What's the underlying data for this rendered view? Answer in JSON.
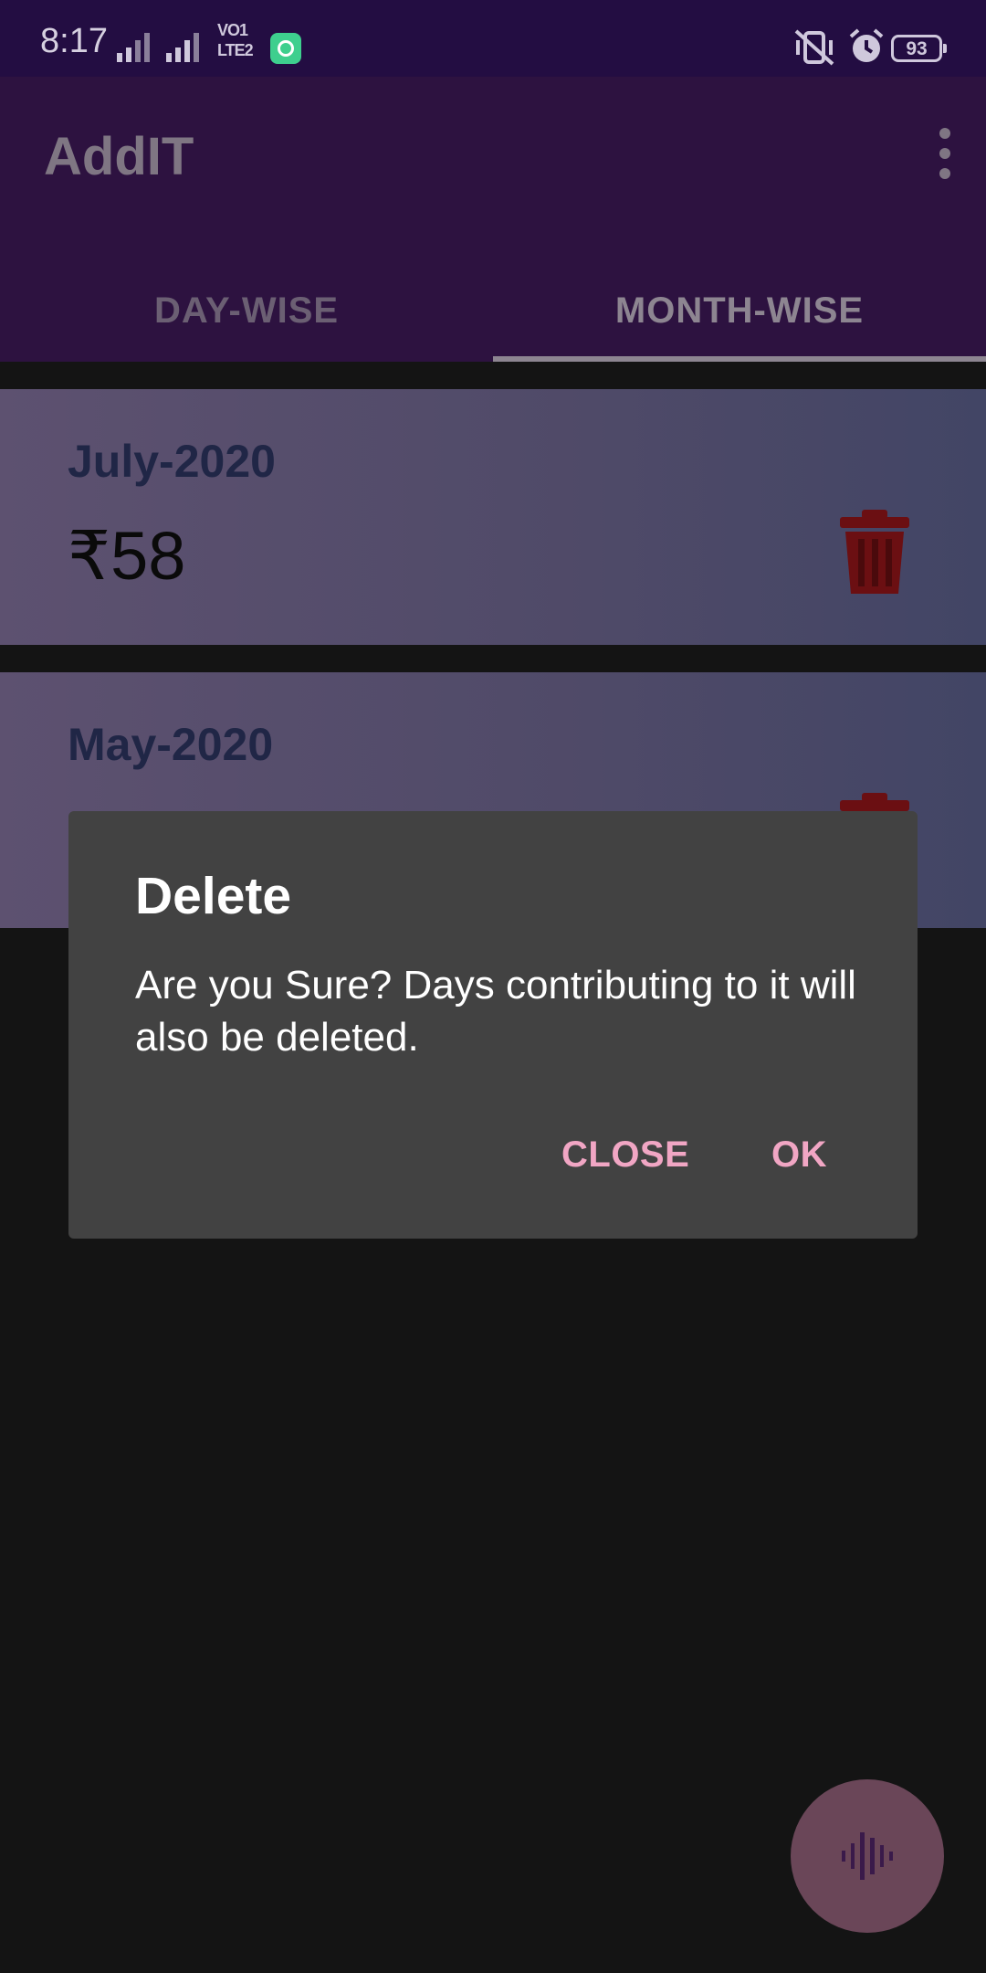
{
  "status_bar": {
    "time": "8:17",
    "network_label_top": "VO",
    "network_label_bottom": "LTE",
    "sim_top": "1",
    "sim_bottom": "2",
    "battery": "93",
    "icons": [
      "signal-icon",
      "signal-icon",
      "volte-icon",
      "app-notification-icon",
      "vibrate-icon",
      "alarm-icon",
      "battery-icon"
    ]
  },
  "app_bar": {
    "title": "AddIT",
    "menu_icon": "overflow-menu-icon"
  },
  "tabs": [
    {
      "label": "DAY-WISE",
      "selected": false
    },
    {
      "label": "MONTH-WISE",
      "selected": true
    }
  ],
  "cards": [
    {
      "month": "July-2020",
      "amount": "₹58",
      "action_icon": "trash-icon"
    },
    {
      "month": "May-2020",
      "amount": "",
      "action_icon": "trash-icon"
    }
  ],
  "dialog": {
    "title": "Delete",
    "message": "Are you Sure? Days contributing to it will also be deleted.",
    "buttons": {
      "close": "CLOSE",
      "ok": "OK"
    }
  },
  "fab": {
    "icon": "voice-wave-icon"
  },
  "colors": {
    "status_bar": "#230d42",
    "app_bar_dimmed": "#2d1240",
    "background": "#141414",
    "dialog_bg": "#424242",
    "dialog_button": "#f1a6c4",
    "trash_dimmed": "#6b0f12"
  }
}
